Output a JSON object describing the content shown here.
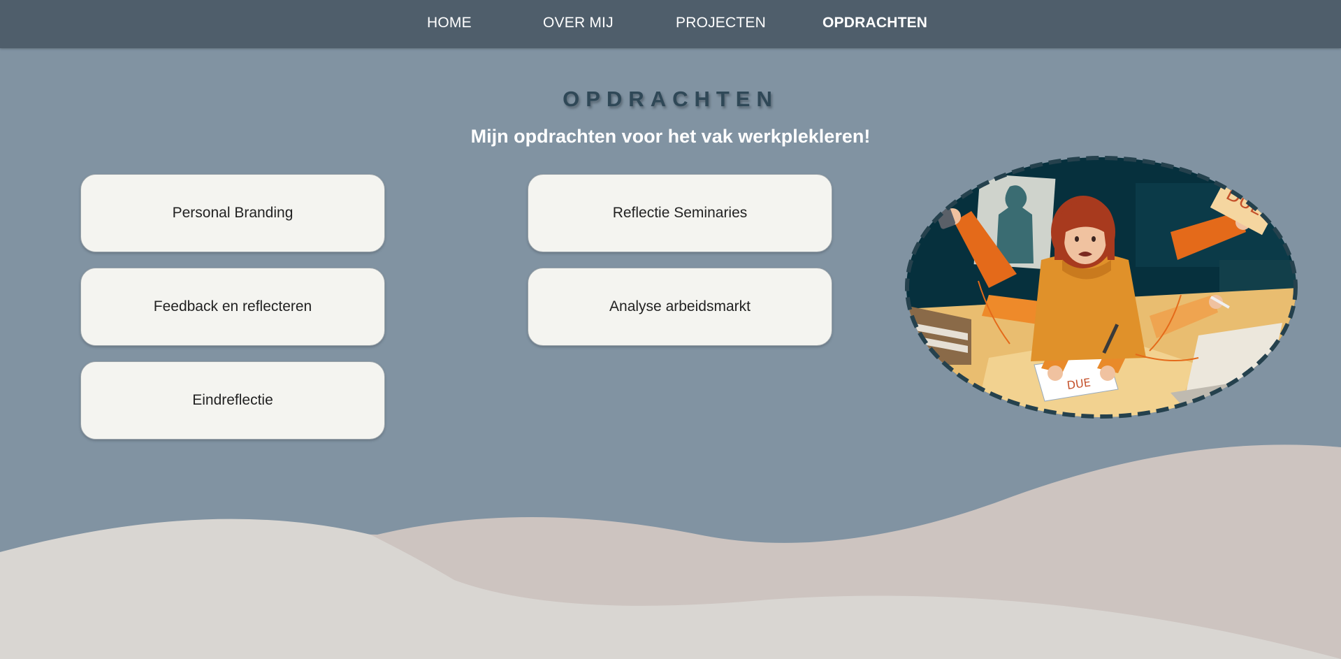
{
  "nav": {
    "items": [
      {
        "label": "HOME"
      },
      {
        "label": "OVER MIJ"
      },
      {
        "label": "PROJECTEN"
      },
      {
        "label": "OPDRACHTEN"
      }
    ]
  },
  "main": {
    "title": "OPDRACHTEN",
    "subtitle": "Mijn opdrachten voor het vak werkplekleren!",
    "cards": [
      {
        "label": "Personal Branding"
      },
      {
        "label": "Reflectie Seminaries"
      },
      {
        "label": "Feedback en reflecteren"
      },
      {
        "label": "Analyse arbeidsmarkt"
      },
      {
        "label": "Eindreflectie"
      }
    ],
    "illustration": {
      "sign_text": "DUE!",
      "paper_text": "DUE"
    }
  },
  "colors": {
    "background": "#8193a2",
    "nav_background": "#4f5e6b",
    "card_background": "#f4f4f0",
    "title_color": "#2f4857",
    "wave_back": "#cdc4c0",
    "wave_front": "#d9d6d2"
  }
}
